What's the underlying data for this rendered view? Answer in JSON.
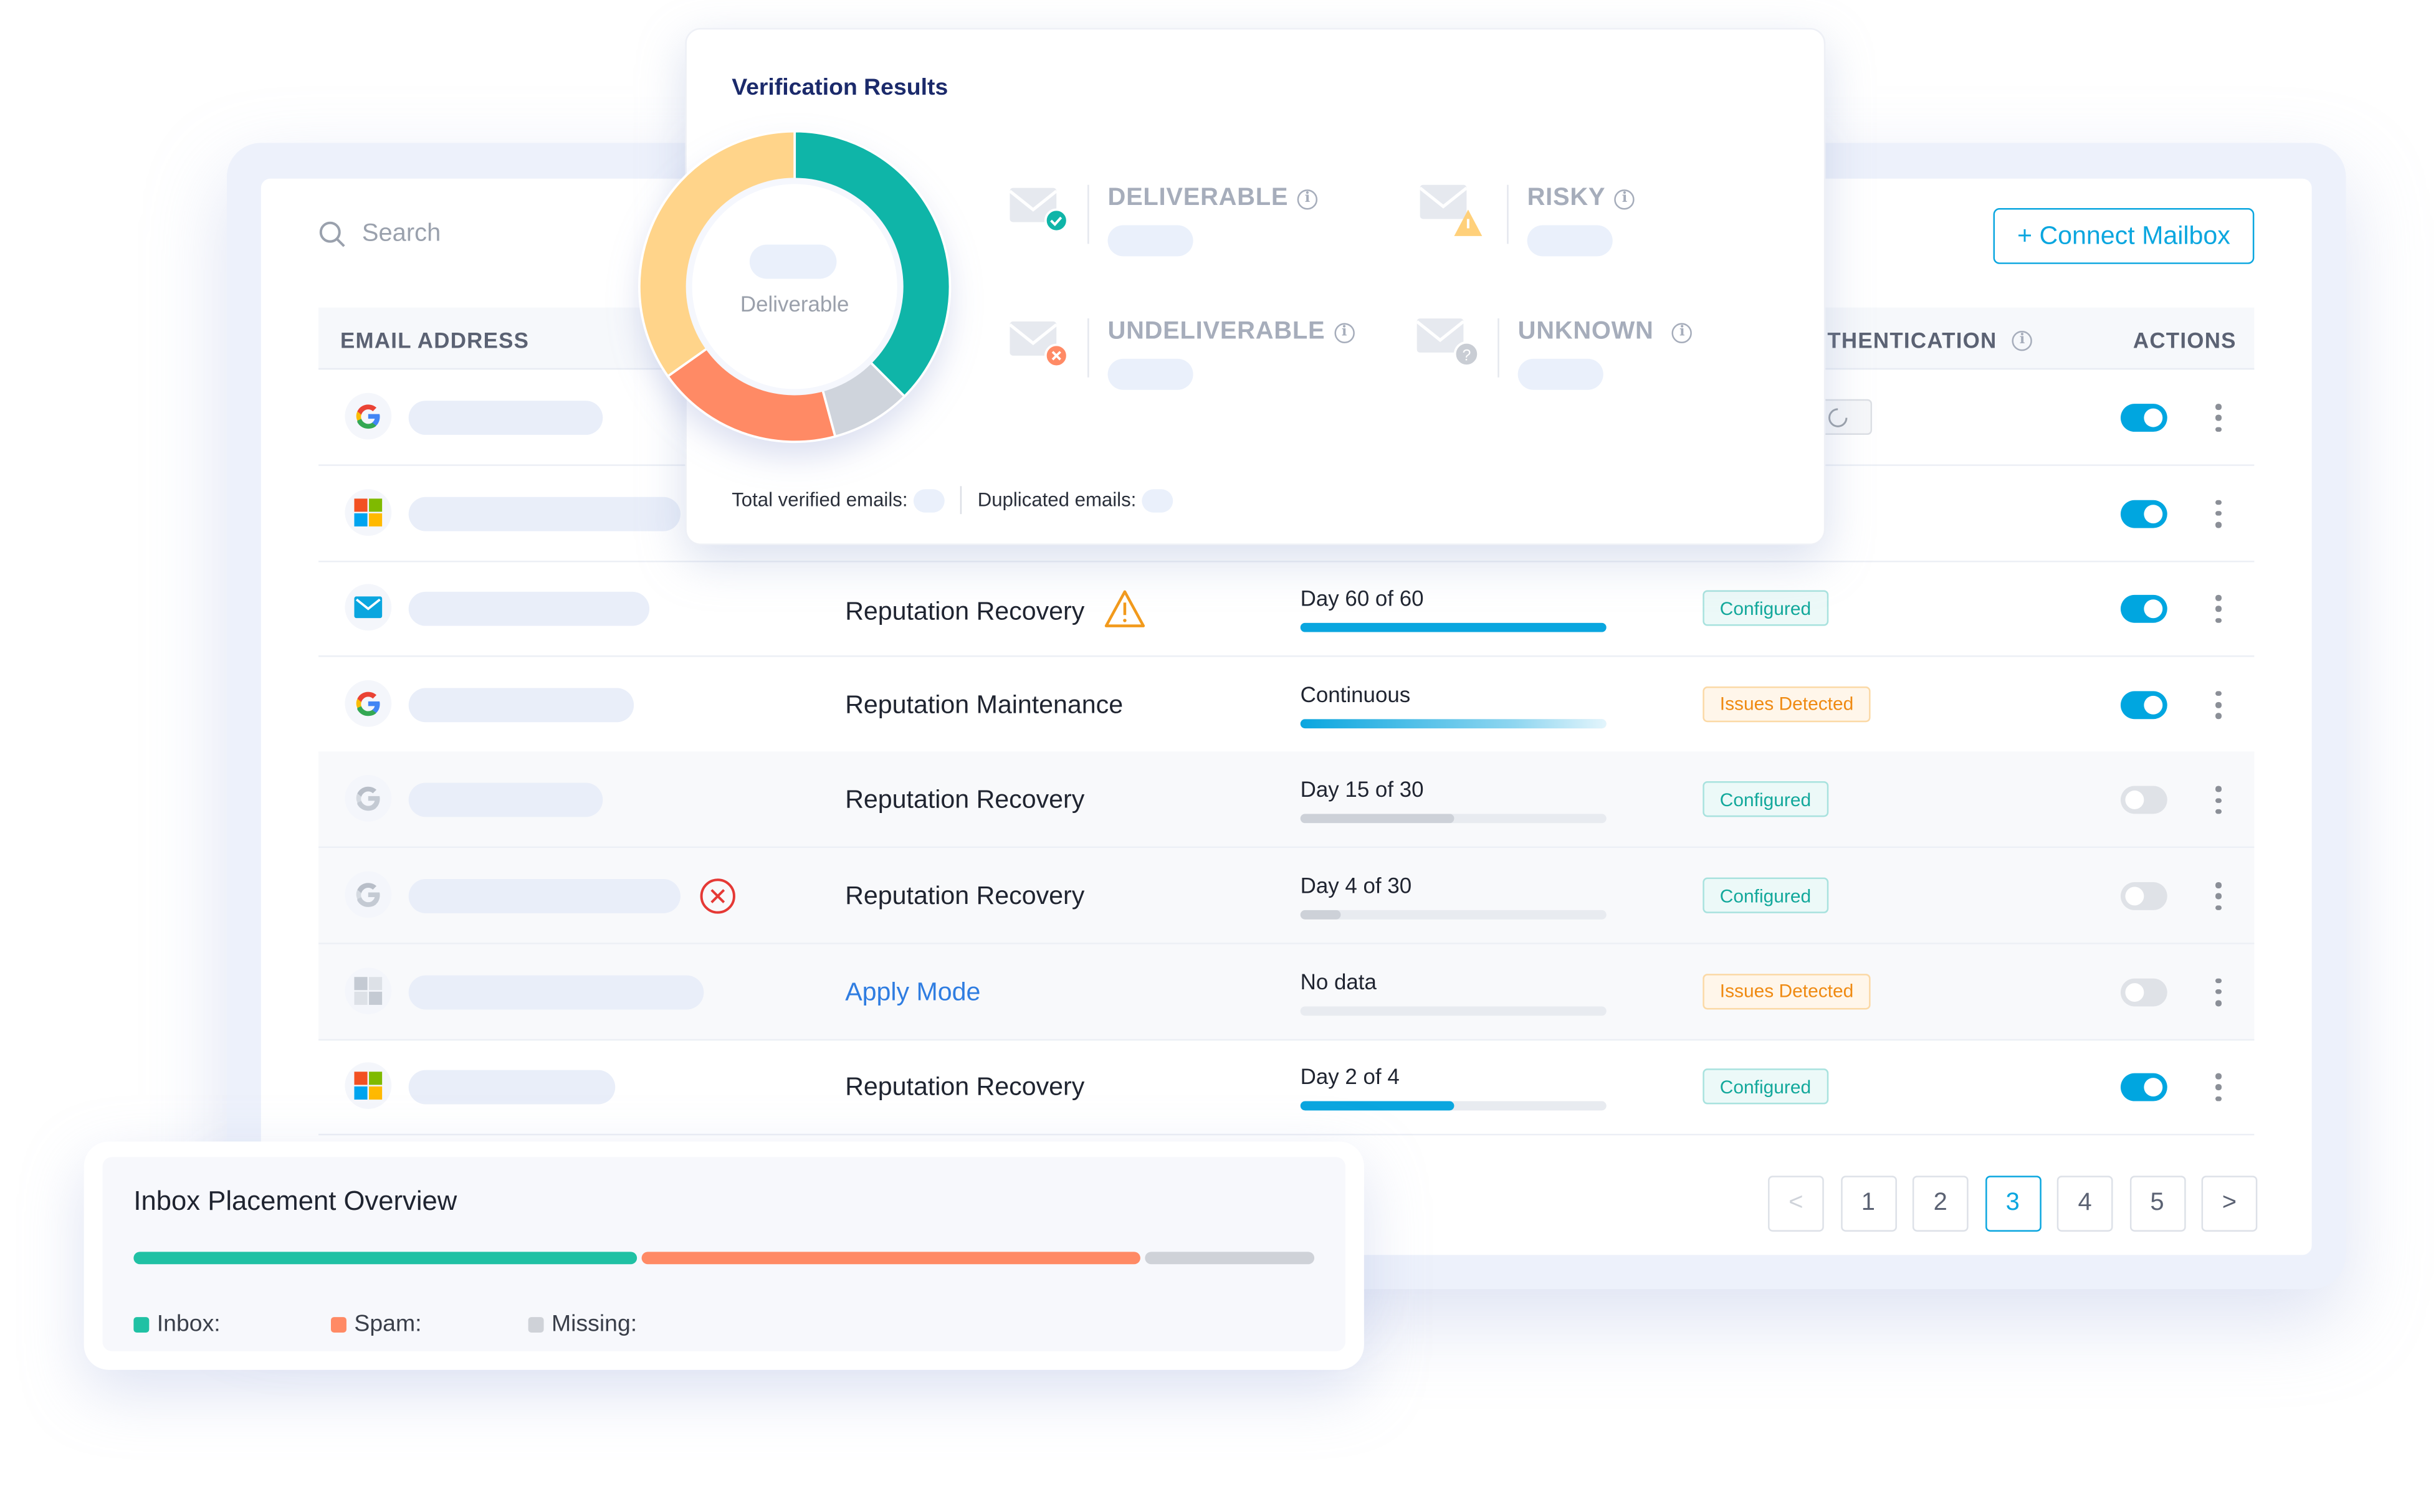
{
  "colors": {
    "accent": "#00a6e0",
    "teal": "#0fb5a8",
    "orange": "#ff8a65",
    "yellow": "#ffd48a",
    "gray": "#cfd4dc",
    "navy": "#1b2a6b"
  },
  "search": {
    "placeholder": "Search",
    "icon": "search-icon"
  },
  "connect_button": "+ Connect Mailbox",
  "table": {
    "headers": {
      "email": "EMAIL ADDRESS",
      "auth": "AUTHENTICATION",
      "actions": "ACTIONS"
    },
    "rows": [
      {
        "provider": "google",
        "dim": false,
        "pill": 125,
        "mode": "",
        "progress_label": "",
        "progress": null,
        "auth": "loading",
        "auth_label": "",
        "enabled": true
      },
      {
        "provider": "microsoft",
        "dim": false,
        "pill": 175,
        "mode": "",
        "progress_label": "",
        "progress": null,
        "auth": "ok",
        "auth_label": "",
        "enabled": true
      },
      {
        "provider": "mail",
        "dim": false,
        "pill": 155,
        "mode": "Reputation Recovery",
        "mode_icon": "warning-icon",
        "progress_label": "Day 60 of 60",
        "progress": 1.0,
        "bar": "blue",
        "auth": "ok",
        "auth_label": "Configured",
        "enabled": true
      },
      {
        "provider": "google",
        "dim": false,
        "pill": 145,
        "mode": "Reputation Maintenance",
        "progress_label": "Continuous",
        "progress": 1.0,
        "bar": "gradient",
        "auth": "warn",
        "auth_label": "Issues Detected",
        "enabled": true
      },
      {
        "provider": "google-gray",
        "dim": true,
        "pill": 125,
        "mode": "Reputation Recovery",
        "progress_label": "Day 15 of 30",
        "progress": 0.5,
        "bar": "gray",
        "auth": "ok",
        "auth_label": "Configured",
        "enabled": false
      },
      {
        "provider": "google-gray",
        "dim": true,
        "pill": 175,
        "email_icon": "error-icon",
        "mode": "Reputation Recovery",
        "progress_label": "Day 4 of 30",
        "progress": 0.133,
        "bar": "gray",
        "auth": "ok",
        "auth_label": "Configured",
        "enabled": false
      },
      {
        "provider": "microsoft-gray",
        "dim": true,
        "pill": 190,
        "mode": "Apply Mode",
        "mode_link": true,
        "progress_label": "No data",
        "progress": 0,
        "bar": "gray",
        "auth": "warn",
        "auth_label": "Issues Detected",
        "enabled": false
      },
      {
        "provider": "microsoft",
        "dim": false,
        "pill": 133,
        "mode": "Reputation Recovery",
        "progress_label": "Day 2 of 4",
        "progress": 0.5,
        "bar": "blue",
        "auth": "ok",
        "auth_label": "Configured",
        "enabled": true
      }
    ]
  },
  "pagination": {
    "prev": "<",
    "pages": [
      "1",
      "2",
      "3",
      "4",
      "5"
    ],
    "current": "3",
    "next": ">"
  },
  "verification": {
    "title": "Verification Results",
    "donut_center_label": "Deliverable",
    "donut": [
      {
        "key": "deliverable",
        "fraction": 0.375,
        "color": "#0fb5a8"
      },
      {
        "key": "unknown",
        "fraction": 0.083,
        "color": "#cfd4dc"
      },
      {
        "key": "undeliverable",
        "fraction": 0.194,
        "color": "#ff8a65"
      },
      {
        "key": "risky",
        "fraction": 0.348,
        "color": "#ffd48a"
      }
    ],
    "stats": {
      "deliverable": "DELIVERABLE",
      "risky": "RISKY",
      "undeliverable": "UNDELIVERABLE",
      "unknown": "UNKNOWN"
    },
    "total_label": "Total verified emails:",
    "duplicated_label": "Duplicated emails:"
  },
  "inbox": {
    "title": "Inbox Placement Overview",
    "segments": [
      {
        "label": "Inbox:",
        "fraction": 0.43,
        "color": "#20c1a4"
      },
      {
        "label": "Spam:",
        "fraction": 0.425,
        "color": "#ff8a65"
      },
      {
        "label": "Missing:",
        "fraction": 0.145,
        "color": "#cfd2d8"
      }
    ]
  }
}
